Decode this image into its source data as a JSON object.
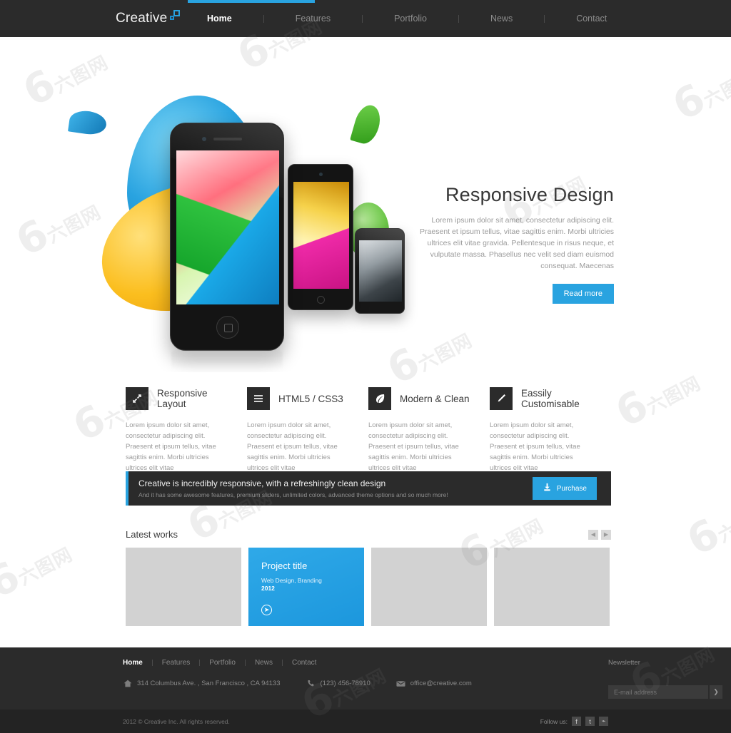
{
  "colors": {
    "accent": "#29a3e0",
    "dark": "#2b2b2b",
    "darker": "#232323",
    "placeholder_gray": "#d2d2d2"
  },
  "header": {
    "brand": "Creative",
    "brand_icon": "square-outline-icon",
    "nav": [
      {
        "label": "Home",
        "active": true
      },
      {
        "label": "Features",
        "active": false
      },
      {
        "label": "Portfolio",
        "active": false
      },
      {
        "label": "News",
        "active": false
      },
      {
        "label": "Contact",
        "active": false
      }
    ]
  },
  "hero": {
    "title": "Responsive Design",
    "description": "Lorem ipsum dolor sit amet, consectetur adipiscing elit. Praesent et ipsum tellus, vitae sagittis enim. Morbi ultricies ultrices elit vitae gravida. Pellentesque in risus neque, et vulputate massa. Phasellus nec velit sed diam euismod consequat. Maecenas",
    "button": "Read more",
    "slider_dots": 3,
    "slider_active_index": 1
  },
  "features": [
    {
      "icon": "resize-arrows-icon",
      "title": "Responsive Layout",
      "text": "Lorem ipsum dolor sit amet, consectetur adipiscing elit. Praesent et ipsum tellus, vitae sagittis enim. Morbi ultricies ultrices elit vitae"
    },
    {
      "icon": "hamburger-lines-icon",
      "title": "HTML5 / CSS3",
      "text": "Lorem ipsum dolor sit amet, consectetur adipiscing elit. Praesent et ipsum tellus, vitae sagittis enim. Morbi ultricies ultrices elit vitae"
    },
    {
      "icon": "leaf-icon",
      "title": "Modern & Clean",
      "text": "Lorem ipsum dolor sit amet, consectetur adipiscing elit. Praesent et ipsum tellus, vitae sagittis enim. Morbi ultricies ultrices elit vitae"
    },
    {
      "icon": "pencil-icon",
      "title": "Eassily Customisable",
      "text": "Lorem ipsum dolor sit amet, consectetur adipiscing elit. Praesent et ipsum tellus, vitae sagittis enim. Morbi ultricies ultrices elit vitae"
    }
  ],
  "cta": {
    "headline": "Creative is incredibly responsive, with a refreshingly clean design",
    "subline": "And it has some awesome features, premium sliders, unlimited colors, advanced theme options and so much more!",
    "button": "Purchase",
    "button_icon": "download-icon"
  },
  "works": {
    "title": "Latest works",
    "prev_icon": "arrow-left-icon",
    "next_icon": "arrow-right-icon",
    "items": [
      {
        "featured": false,
        "title": "",
        "category": "",
        "year": ""
      },
      {
        "featured": true,
        "title": "Project title",
        "category": "Web Design, Branding",
        "year": "2012",
        "go_icon": "arrow-right-circle-icon"
      },
      {
        "featured": false,
        "title": "",
        "category": "",
        "year": ""
      },
      {
        "featured": false,
        "title": "",
        "category": "",
        "year": ""
      }
    ]
  },
  "footer": {
    "links": [
      {
        "label": "Home",
        "active": true
      },
      {
        "label": "Features",
        "active": false
      },
      {
        "label": "Portfolio",
        "active": false
      },
      {
        "label": "News",
        "active": false
      },
      {
        "label": "Contact",
        "active": false
      }
    ],
    "address": "314 Columbus Ave. , San Francisco , CA 94133",
    "address_icon": "home-icon",
    "phone": "(123) 456-78910",
    "phone_icon": "phone-icon",
    "email": "office@creative.com",
    "email_icon": "envelope-icon",
    "newsletter_label": "Newsletter",
    "newsletter_placeholder": "E-mail address",
    "newsletter_submit_icon": "chevron-right-icon"
  },
  "bottom": {
    "copyright": "2012 © Creative Inc. All rights reserved.",
    "follow_label": "Follow us:",
    "social": [
      {
        "name": "facebook-icon",
        "glyph": "f"
      },
      {
        "name": "twitter-icon",
        "glyph": "t"
      },
      {
        "name": "rss-icon",
        "glyph": "⌁"
      }
    ]
  },
  "watermark": {
    "text": "6",
    "sub": "六图网"
  }
}
